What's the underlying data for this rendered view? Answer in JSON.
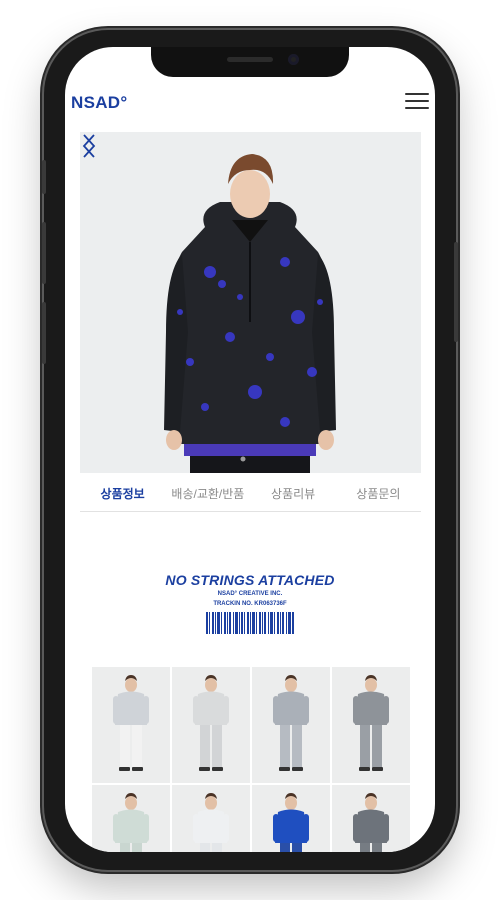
{
  "header": {
    "logo": "NSAD°",
    "menu_icon": "hamburger-menu-icon"
  },
  "carousel": {
    "prev_icon": "chevron-left-icon",
    "next_icon": "chevron-right-icon",
    "product": "black anorak jacket with blue splash print",
    "accent_color": "#1b3fa0"
  },
  "tabs": [
    {
      "label": "상품정보",
      "active": true
    },
    {
      "label": "배송/교환/반품",
      "active": false
    },
    {
      "label": "상품리뷰",
      "active": false
    },
    {
      "label": "상품문의",
      "active": false
    }
  ],
  "banner": {
    "slogan": "NO STRINGS ATTACHED",
    "line1": "NSAD° CREATIVE INC.",
    "line2": "TRACKIN NO. KR063736F"
  },
  "grid": [
    {
      "outfit": "silver puffer, white pants",
      "top": "#cfd3d8",
      "bottom": "#f2f2f2"
    },
    {
      "outfit": "light grey jacket set",
      "top": "#d9dbdc",
      "bottom": "#d2d4d6"
    },
    {
      "outfit": "grey pullover, grey cargo pants",
      "top": "#aab0b8",
      "bottom": "#b6bbc2"
    },
    {
      "outfit": "grey track jacket set",
      "top": "#8e9399",
      "bottom": "#9a9fa5"
    },
    {
      "outfit": "mint sweatshirt",
      "top": "#cfdcd6",
      "bottom": "#c9d6d0"
    },
    {
      "outfit": "white print hoodie",
      "top": "#eef0f2",
      "bottom": "#e3e6e9"
    },
    {
      "outfit": "blue sweatshirt",
      "top": "#1f4fc0",
      "bottom": "#2a4fa8"
    },
    {
      "outfit": "grey shell jacket",
      "top": "#6d737b",
      "bottom": "#767c83"
    }
  ]
}
